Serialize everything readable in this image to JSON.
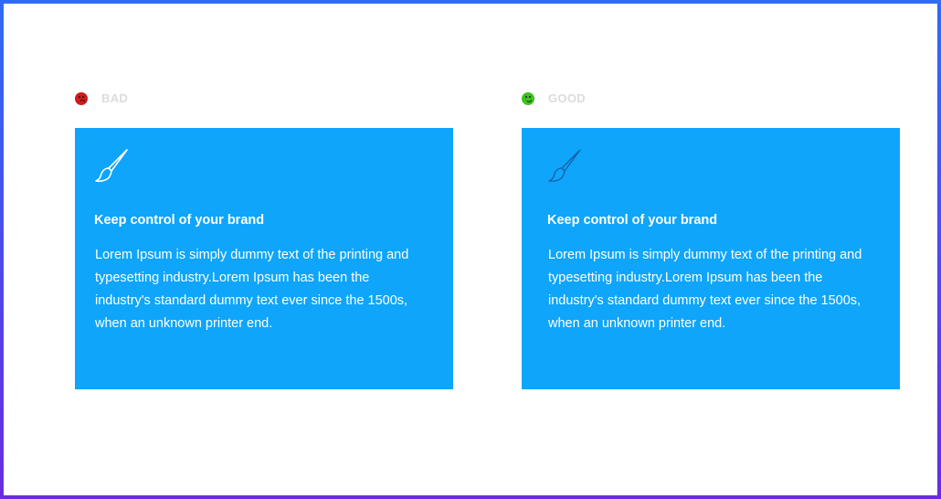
{
  "comparisons": [
    {
      "label": "BAD",
      "face_icon": "sad-face-icon",
      "face_color": "#d11a1a",
      "brush_color": "#ffffff",
      "title": "Keep control of your brand",
      "body": "Lorem Ipsum is simply dummy text of the printing and typesetting industry.Lorem Ipsum has been the industry's standard dummy text ever since the 1500s, when an unknown printer end."
    },
    {
      "label": "GOOD",
      "face_icon": "happy-face-icon",
      "face_color": "#3cc21e",
      "brush_color": "#1560a8",
      "title": "Keep control of your brand",
      "body": "Lorem Ipsum is simply dummy text of the printing and typesetting industry.Lorem Ipsum has been the industry's standard dummy text ever since the 1500s, when an unknown printer end."
    }
  ],
  "colors": {
    "card_background": "#0ea5fa",
    "label_text": "#dcdcdc",
    "frame_gradient_top": "#2f6cf3",
    "frame_gradient_bottom": "#6a2be0"
  }
}
